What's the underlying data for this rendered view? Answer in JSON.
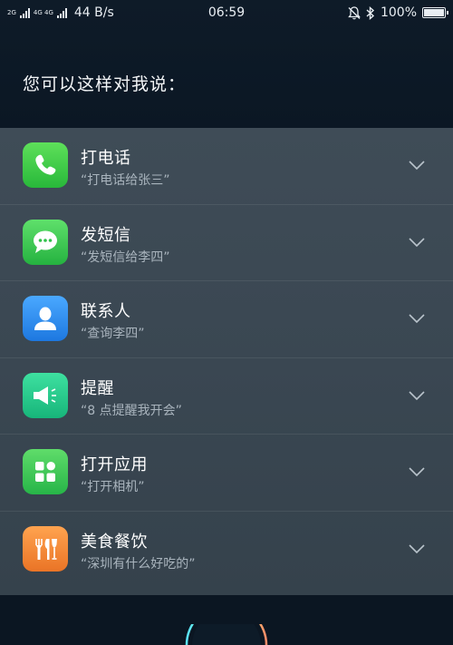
{
  "status_bar": {
    "network_tag_1": "2G",
    "network_tag_2": "4G 4G",
    "speed": "44 B/s",
    "time": "06:59",
    "battery": "100%",
    "battery_level": 1.0
  },
  "prompt": "您可以这样对我说：",
  "items": [
    {
      "title": "打电话",
      "example": "“打电话给张三”",
      "icon": "phone-icon",
      "color": "#34c759"
    },
    {
      "title": "发短信",
      "example": "“发短信给李四”",
      "icon": "message-icon",
      "color": "#30c24a"
    },
    {
      "title": "联系人",
      "example": "“查询李四”",
      "icon": "contact-icon",
      "color": "#2f8ff0"
    },
    {
      "title": "提醒",
      "example": "“8 点提醒我开会”",
      "icon": "megaphone-icon",
      "color": "#26c488"
    },
    {
      "title": "打开应用",
      "example": "“打开相机”",
      "icon": "apps-grid-icon",
      "color": "#3ccf5a"
    },
    {
      "title": "美食餐饮",
      "example": "“深圳有什么好吃的”",
      "icon": "dining-icon",
      "color": "#f0873a"
    }
  ]
}
